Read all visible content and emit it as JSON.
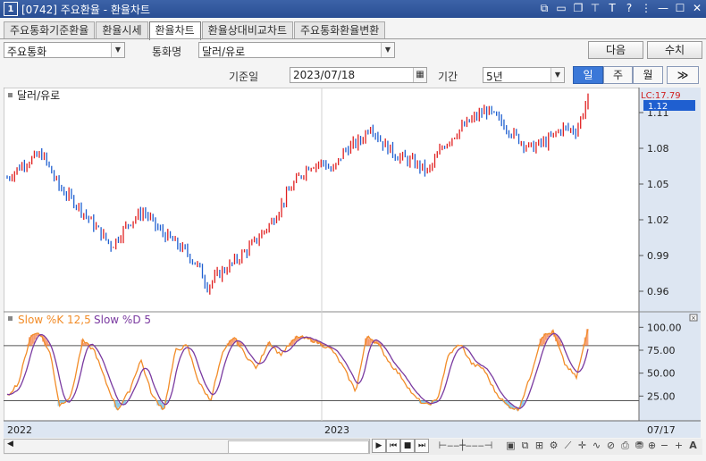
{
  "window": {
    "number": "1",
    "title": "[0742] 주요환율 - 환율차트"
  },
  "tabs": [
    {
      "label": "주요통화기준환율",
      "active": false
    },
    {
      "label": "환율시세",
      "active": false
    },
    {
      "label": "환율차트",
      "active": true
    },
    {
      "label": "환율상대비교차트",
      "active": false
    },
    {
      "label": "주요통화환율변환",
      "active": false
    }
  ],
  "controls": {
    "category": "주요통화",
    "currency_label": "통화명",
    "currency": "달러/유로",
    "prev_button": "다음",
    "view_button": "수치",
    "date_label": "기준일",
    "date": "2023/07/18",
    "period_label": "기간",
    "period": "5년",
    "daily": "일",
    "weekly": "주",
    "monthly": "월",
    "next": "≫"
  },
  "colors": {
    "up": "#e02020",
    "down": "#1f5fd0",
    "slowK": "#f28c28",
    "slowD": "#7a3aa0",
    "accent": "#3b78d8"
  },
  "chart_data": [
    {
      "type": "candlestick",
      "title": "달러/유로",
      "current_label": "LC:17.79",
      "current_value": "1.12",
      "y_ticks": [
        "1.11",
        "1.08",
        "1.05",
        "1.02",
        "0.99",
        "0.96"
      ],
      "y_tick_values": [
        1.11,
        1.08,
        1.05,
        1.02,
        0.99,
        0.96
      ],
      "ylim": [
        0.945,
        1.128
      ],
      "x_labels": [
        "2022",
        "2023"
      ],
      "last_date": "07/17",
      "path": [
        [
          0,
          1.055
        ],
        [
          0.03,
          1.068
        ],
        [
          0.06,
          1.075
        ],
        [
          0.09,
          1.047
        ],
        [
          0.12,
          1.033
        ],
        [
          0.15,
          1.015
        ],
        [
          0.18,
          0.998
        ],
        [
          0.21,
          1.018
        ],
        [
          0.235,
          1.027
        ],
        [
          0.26,
          1.012
        ],
        [
          0.285,
          1.002
        ],
        [
          0.31,
          0.992
        ],
        [
          0.33,
          0.98
        ],
        [
          0.345,
          0.964
        ],
        [
          0.365,
          0.975
        ],
        [
          0.385,
          0.982
        ],
        [
          0.42,
          0.998
        ],
        [
          0.455,
          1.018
        ],
        [
          0.49,
          1.048
        ],
        [
          0.52,
          1.066
        ],
        [
          0.545,
          1.068
        ],
        [
          0.56,
          1.06
        ],
        [
          0.58,
          1.078
        ],
        [
          0.61,
          1.087
        ],
        [
          0.625,
          1.1
        ],
        [
          0.645,
          1.085
        ],
        [
          0.67,
          1.074
        ],
        [
          0.7,
          1.068
        ],
        [
          0.725,
          1.06
        ],
        [
          0.75,
          1.082
        ],
        [
          0.775,
          1.094
        ],
        [
          0.8,
          1.104
        ],
        [
          0.825,
          1.112
        ],
        [
          0.855,
          1.1
        ],
        [
          0.875,
          1.09
        ],
        [
          0.9,
          1.08
        ],
        [
          0.93,
          1.086
        ],
        [
          0.955,
          1.097
        ],
        [
          0.98,
          1.095
        ],
        [
          1.0,
          1.122
        ]
      ]
    },
    {
      "type": "line",
      "title": "Slow %K 12,5",
      "title2": "Slow %D 5",
      "y_ticks": [
        "100.00",
        "75.00",
        "50.00",
        "25.00"
      ],
      "y_tick_values": [
        100,
        75,
        50,
        25
      ],
      "ylim": [
        0,
        112
      ],
      "levels": [
        80,
        20
      ],
      "cycle_points": [
        [
          0,
          25
        ],
        [
          0.02,
          40
        ],
        [
          0.04,
          90
        ],
        [
          0.055,
          95
        ],
        [
          0.075,
          70
        ],
        [
          0.09,
          15
        ],
        [
          0.11,
          25
        ],
        [
          0.13,
          85
        ],
        [
          0.15,
          75
        ],
        [
          0.17,
          40
        ],
        [
          0.19,
          10
        ],
        [
          0.21,
          30
        ],
        [
          0.23,
          65
        ],
        [
          0.25,
          25
        ],
        [
          0.27,
          10
        ],
        [
          0.29,
          75
        ],
        [
          0.31,
          80
        ],
        [
          0.33,
          40
        ],
        [
          0.35,
          20
        ],
        [
          0.37,
          70
        ],
        [
          0.39,
          90
        ],
        [
          0.41,
          70
        ],
        [
          0.43,
          55
        ],
        [
          0.45,
          85
        ],
        [
          0.47,
          70
        ],
        [
          0.5,
          90
        ],
        [
          0.53,
          85
        ],
        [
          0.56,
          75
        ],
        [
          0.58,
          55
        ],
        [
          0.6,
          30
        ],
        [
          0.62,
          92
        ],
        [
          0.64,
          80
        ],
        [
          0.66,
          60
        ],
        [
          0.68,
          45
        ],
        [
          0.7,
          25
        ],
        [
          0.72,
          15
        ],
        [
          0.74,
          20
        ],
        [
          0.76,
          70
        ],
        [
          0.78,
          82
        ],
        [
          0.8,
          60
        ],
        [
          0.82,
          55
        ],
        [
          0.84,
          30
        ],
        [
          0.86,
          15
        ],
        [
          0.88,
          10
        ],
        [
          0.9,
          45
        ],
        [
          0.92,
          90
        ],
        [
          0.94,
          95
        ],
        [
          0.96,
          60
        ],
        [
          0.98,
          45
        ],
        [
          1.0,
          98
        ]
      ]
    }
  ]
}
